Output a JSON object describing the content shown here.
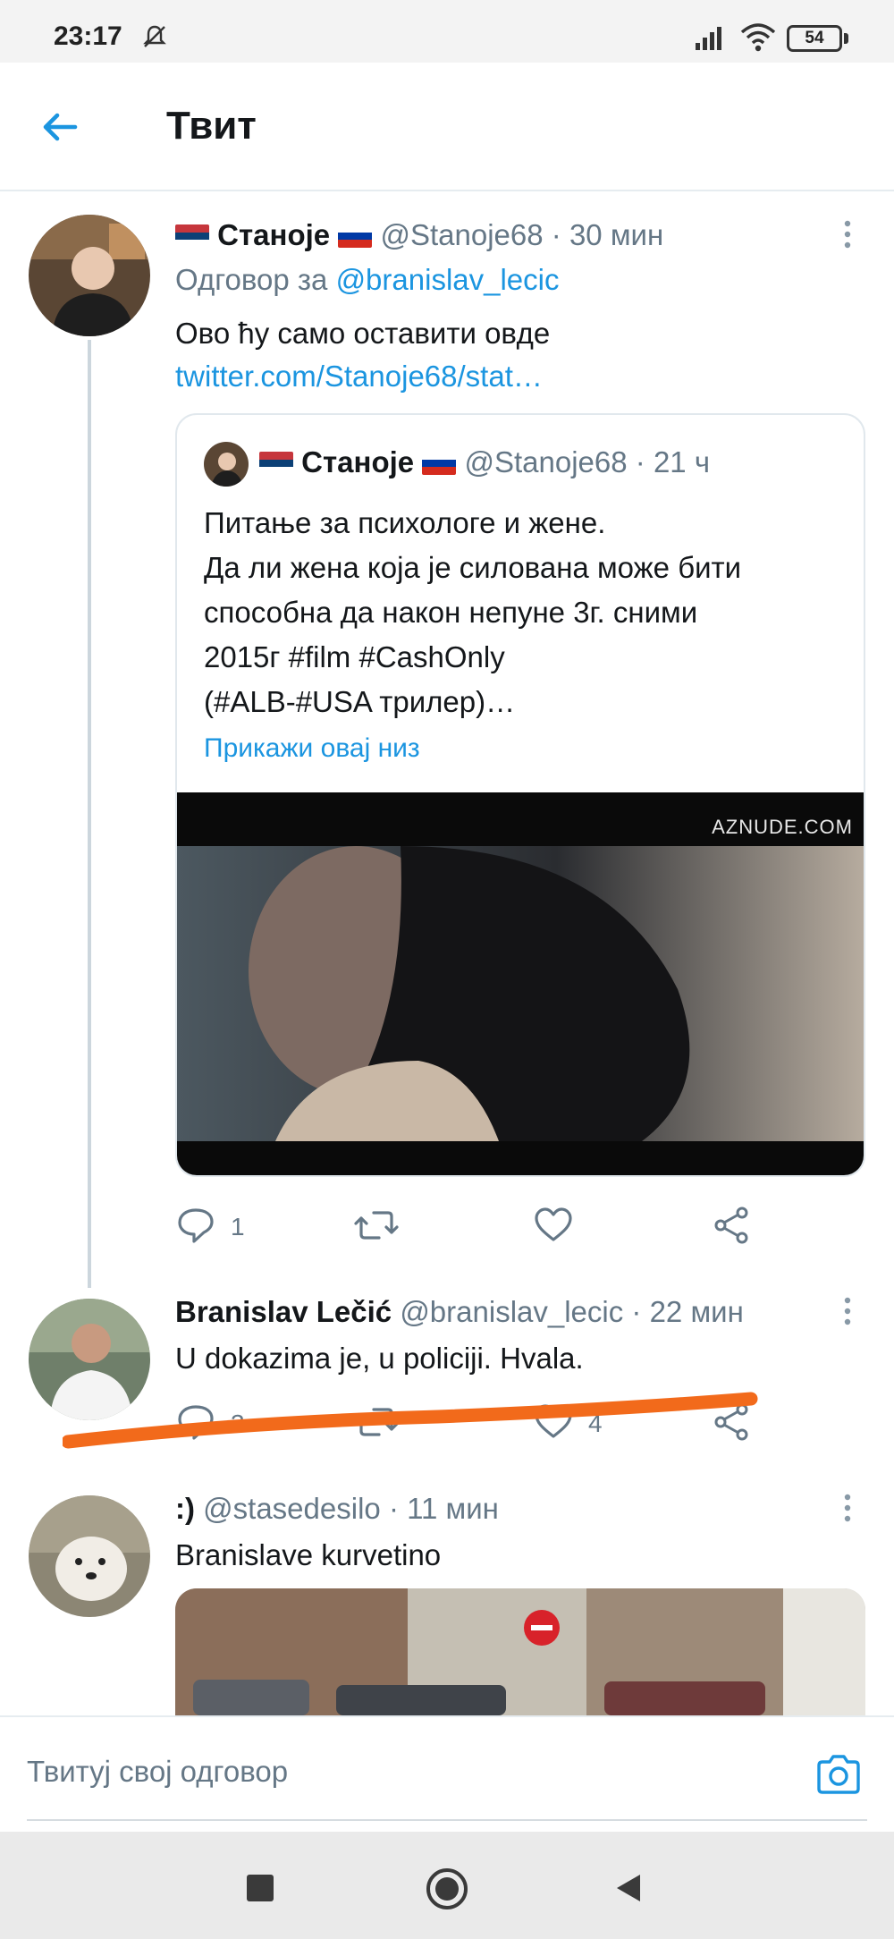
{
  "status_bar": {
    "time": "23:17",
    "battery": "54"
  },
  "header": {
    "title": "Твит"
  },
  "main_tweet": {
    "name": "Станоје",
    "handle": "@Stanoje68",
    "time": "· 30 мин",
    "reply_to_label": "Одговор за ",
    "reply_to_handle": "@branislav_lecic",
    "text": "Ово ћу само оставити овде",
    "link": "twitter.com/Stanoje68/stat…",
    "quoted": {
      "name": "Станоје",
      "handle": "@Stanoje68",
      "time": "· 21 ч",
      "lines": [
        "Питање за психологе и жене.",
        "Да ли жена која је силована може бити",
        "способна да након непуне 3г. сними",
        "2015г #film #CashOnly",
        "(#ALB-#USA трилер)…"
      ],
      "show_thread": "Прикажи овај низ",
      "media_watermark": "AZNUDE.COM"
    },
    "replies": "1"
  },
  "reply_tweet": {
    "name": "Branislav Lečić",
    "handle": "@branislav_lecic",
    "time": "· 22 мин",
    "text": "U dokazima je, u policiji. Hvala.",
    "replies": "3",
    "likes": "4"
  },
  "third_tweet": {
    "name": ":)",
    "handle": "@stasedesilo",
    "time": "· 11 мин",
    "text": "Branislave kurvetino"
  },
  "compose": {
    "placeholder": "Твитуј свој одговор"
  },
  "colors": {
    "accent": "#1b95e0",
    "annotation": "#f26a1b"
  }
}
